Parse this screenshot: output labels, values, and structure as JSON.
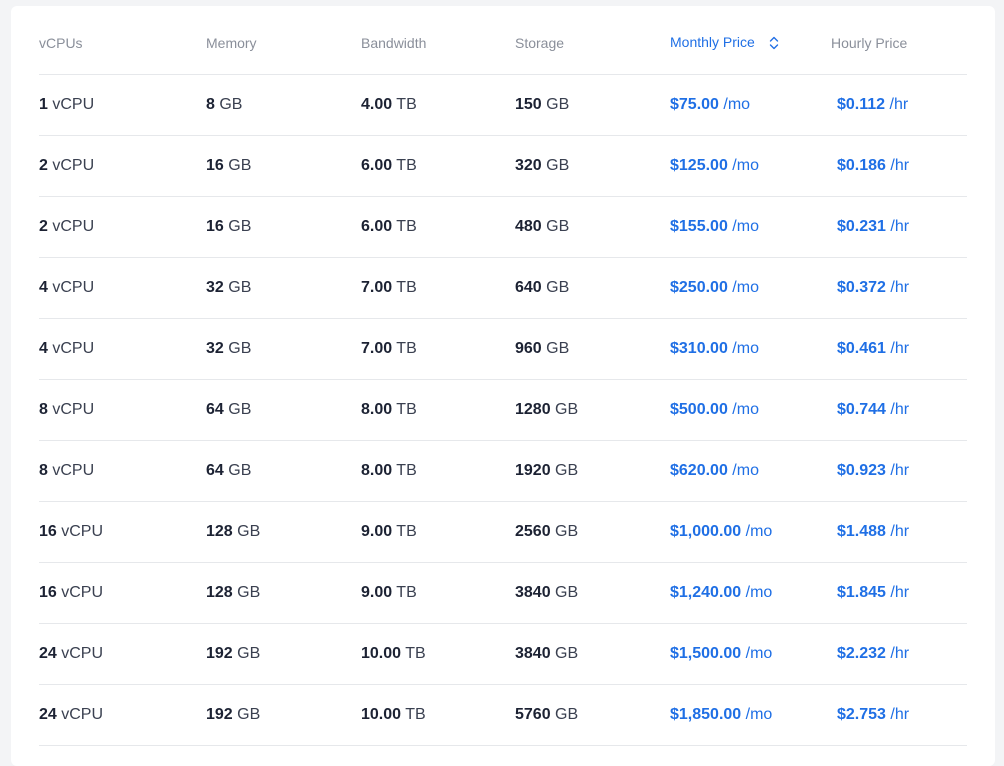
{
  "header": {
    "vcpus": "vCPUs",
    "memory": "Memory",
    "bandwidth": "Bandwidth",
    "storage": "Storage",
    "monthly": "Monthly Price",
    "hourly": "Hourly Price"
  },
  "units": {
    "vcpu": "vCPU",
    "gb": "GB",
    "tb": "TB",
    "mo": "/mo",
    "hr": "/hr"
  },
  "accent_color": "#1f6fe5",
  "sort": {
    "column": "monthly",
    "icon": "sort-updown-icon"
  },
  "rows": [
    {
      "vcpus": "1",
      "memory": "8",
      "bandwidth": "4.00",
      "storage": "150",
      "monthly": "$75.00",
      "hourly": "$0.112"
    },
    {
      "vcpus": "2",
      "memory": "16",
      "bandwidth": "6.00",
      "storage": "320",
      "monthly": "$125.00",
      "hourly": "$0.186"
    },
    {
      "vcpus": "2",
      "memory": "16",
      "bandwidth": "6.00",
      "storage": "480",
      "monthly": "$155.00",
      "hourly": "$0.231"
    },
    {
      "vcpus": "4",
      "memory": "32",
      "bandwidth": "7.00",
      "storage": "640",
      "monthly": "$250.00",
      "hourly": "$0.372"
    },
    {
      "vcpus": "4",
      "memory": "32",
      "bandwidth": "7.00",
      "storage": "960",
      "monthly": "$310.00",
      "hourly": "$0.461"
    },
    {
      "vcpus": "8",
      "memory": "64",
      "bandwidth": "8.00",
      "storage": "1280",
      "monthly": "$500.00",
      "hourly": "$0.744"
    },
    {
      "vcpus": "8",
      "memory": "64",
      "bandwidth": "8.00",
      "storage": "1920",
      "monthly": "$620.00",
      "hourly": "$0.923"
    },
    {
      "vcpus": "16",
      "memory": "128",
      "bandwidth": "9.00",
      "storage": "2560",
      "monthly": "$1,000.00",
      "hourly": "$1.488"
    },
    {
      "vcpus": "16",
      "memory": "128",
      "bandwidth": "9.00",
      "storage": "3840",
      "monthly": "$1,240.00",
      "hourly": "$1.845"
    },
    {
      "vcpus": "24",
      "memory": "192",
      "bandwidth": "10.00",
      "storage": "3840",
      "monthly": "$1,500.00",
      "hourly": "$2.232"
    },
    {
      "vcpus": "24",
      "memory": "192",
      "bandwidth": "10.00",
      "storage": "5760",
      "monthly": "$1,850.00",
      "hourly": "$2.753"
    }
  ]
}
